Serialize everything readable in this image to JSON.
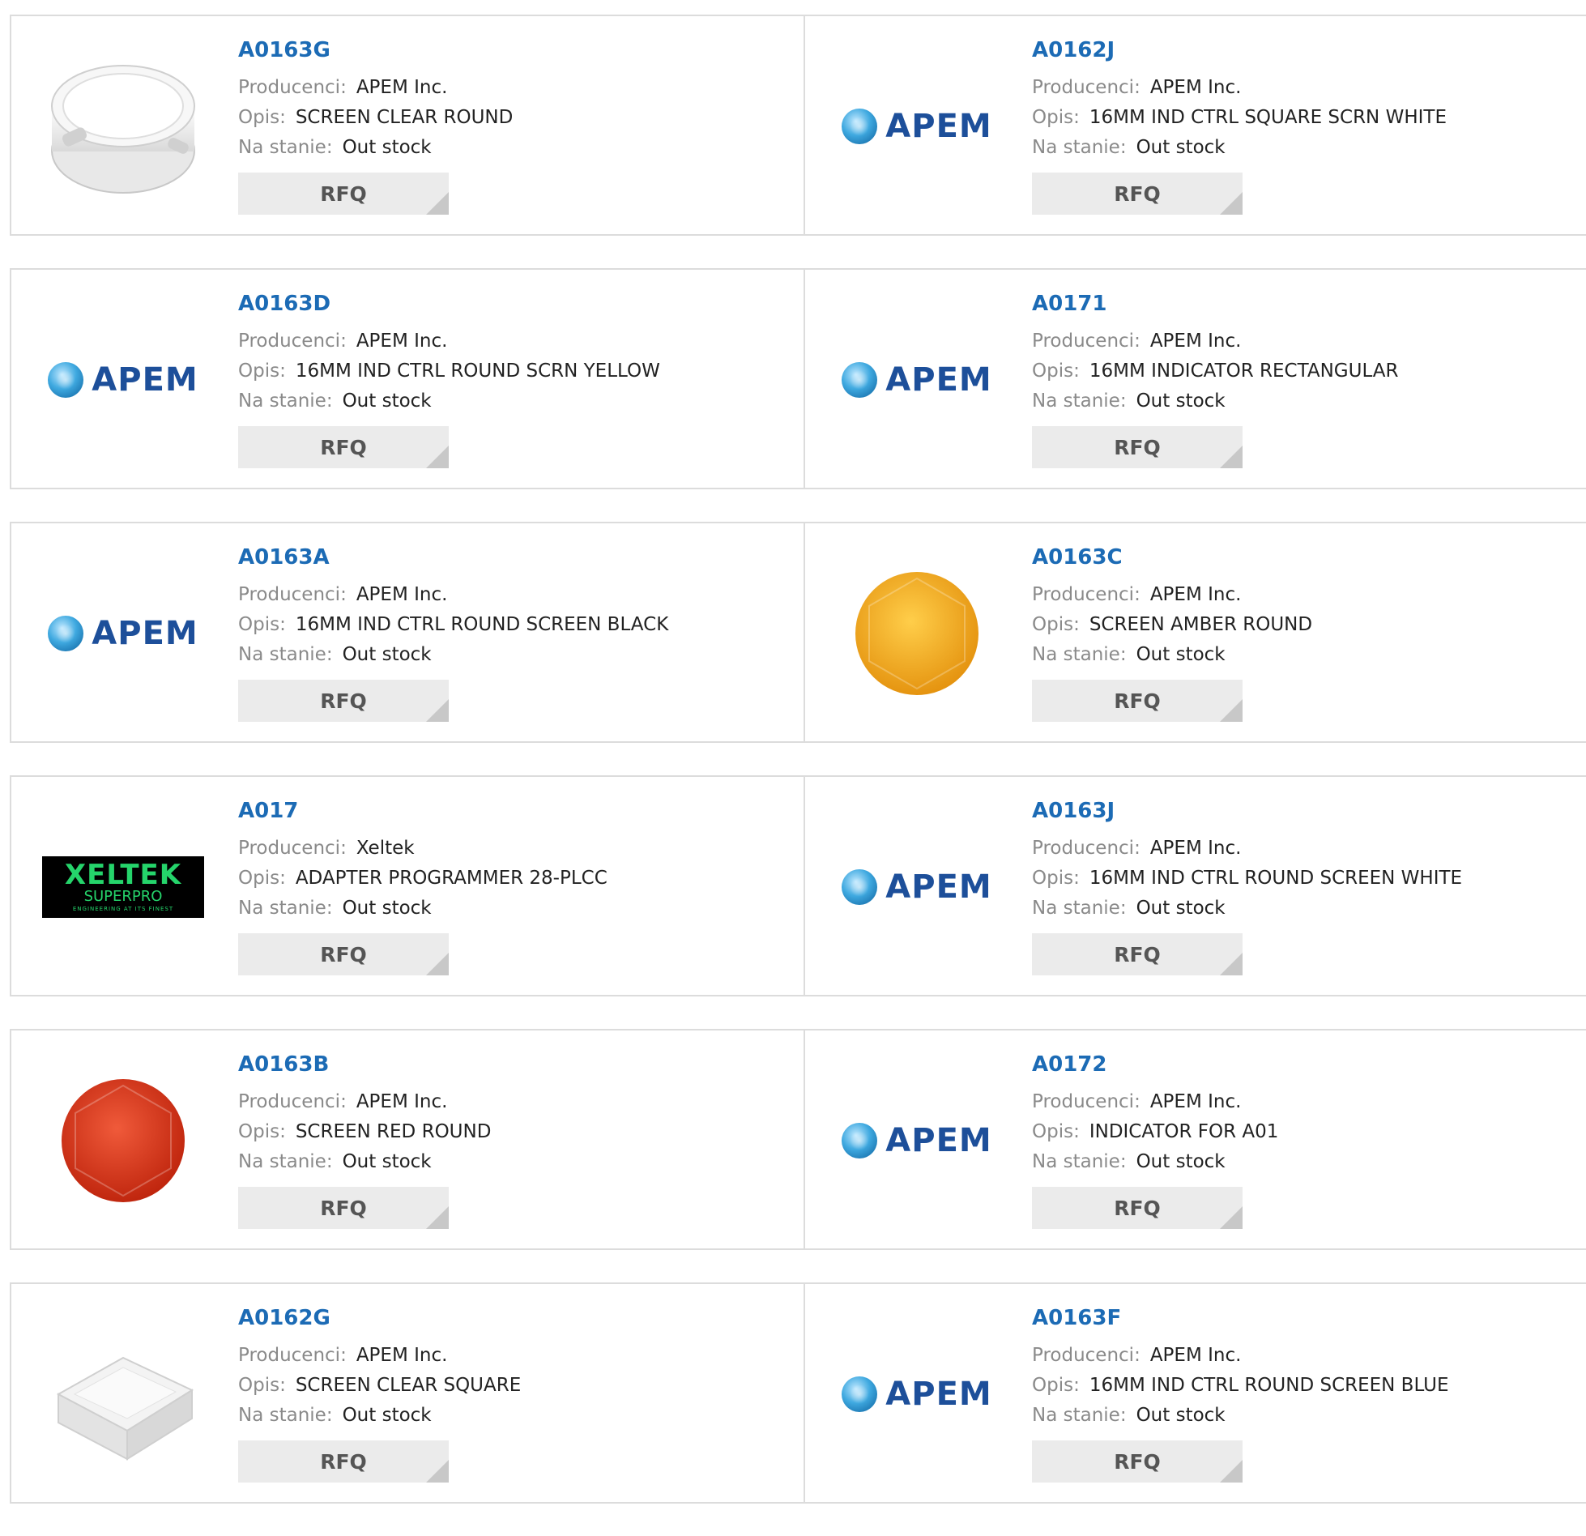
{
  "labels": {
    "manufacturer": "Producenci:",
    "description": "Opis:",
    "stock": "Na stanie:",
    "rfq": "RFQ"
  },
  "logos": {
    "apem": "APEM",
    "xeltek_top": "XELTEK",
    "xeltek_bottom": "SUPERPRO",
    "xeltek_tagline": "ENGINEERING AT ITS FINEST"
  },
  "colors": {
    "part_link": "#1c6bb5",
    "rfq_bg": "#ebebeb",
    "border": "#dcdcdc"
  },
  "products": [
    {
      "part": "A0163G",
      "manufacturer": "APEM Inc.",
      "description": "SCREEN CLEAR ROUND",
      "stock": "Out stock",
      "image": "clear-round-screen"
    },
    {
      "part": "A0162J",
      "manufacturer": "APEM Inc.",
      "description": "16MM IND CTRL SQUARE SCRN WHITE",
      "stock": "Out stock",
      "image": "apem-logo"
    },
    {
      "part": "A0163D",
      "manufacturer": "APEM Inc.",
      "description": "16MM IND CTRL ROUND SCRN YELLOW",
      "stock": "Out stock",
      "image": "apem-logo"
    },
    {
      "part": "A0171",
      "manufacturer": "APEM Inc.",
      "description": "16MM INDICATOR RECTANGULAR",
      "stock": "Out stock",
      "image": "apem-logo"
    },
    {
      "part": "A0163A",
      "manufacturer": "APEM Inc.",
      "description": "16MM IND CTRL ROUND SCREEN BLACK",
      "stock": "Out stock",
      "image": "apem-logo"
    },
    {
      "part": "A0163C",
      "manufacturer": "APEM Inc.",
      "description": "SCREEN AMBER ROUND",
      "stock": "Out stock",
      "image": "amber-round-screen"
    },
    {
      "part": "A017",
      "manufacturer": "Xeltek",
      "description": "ADAPTER PROGRAMMER 28-PLCC",
      "stock": "Out stock",
      "image": "xeltek-logo"
    },
    {
      "part": "A0163J",
      "manufacturer": "APEM Inc.",
      "description": "16MM IND CTRL ROUND SCREEN WHITE",
      "stock": "Out stock",
      "image": "apem-logo"
    },
    {
      "part": "A0163B",
      "manufacturer": "APEM Inc.",
      "description": "SCREEN RED ROUND",
      "stock": "Out stock",
      "image": "red-round-screen"
    },
    {
      "part": "A0172",
      "manufacturer": "APEM Inc.",
      "description": "INDICATOR FOR A01",
      "stock": "Out stock",
      "image": "apem-logo"
    },
    {
      "part": "A0162G",
      "manufacturer": "APEM Inc.",
      "description": "SCREEN CLEAR SQUARE",
      "stock": "Out stock",
      "image": "clear-square-screen"
    },
    {
      "part": "A0163F",
      "manufacturer": "APEM Inc.",
      "description": "16MM IND CTRL ROUND SCREEN BLUE",
      "stock": "Out stock",
      "image": "apem-logo"
    }
  ]
}
